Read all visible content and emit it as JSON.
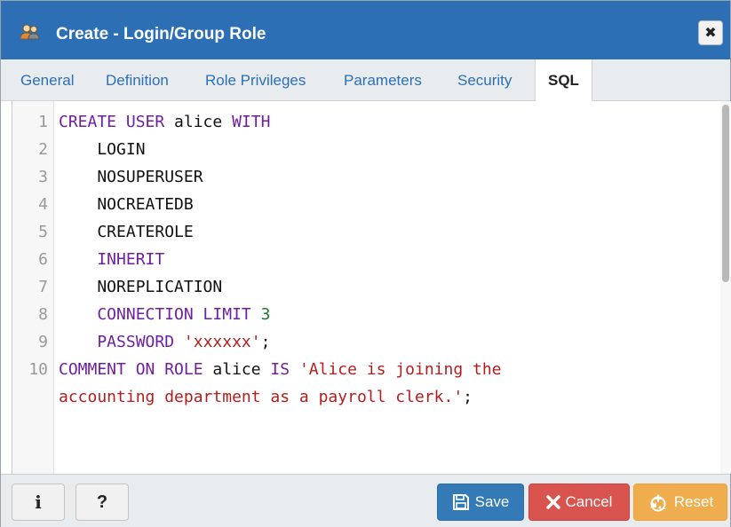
{
  "dialog": {
    "title": "Create - Login/Group Role",
    "close_glyph": "✖"
  },
  "tabs": [
    {
      "label": "General",
      "active": false
    },
    {
      "label": "Definition",
      "active": false
    },
    {
      "label": "Role Privileges",
      "active": false
    },
    {
      "label": "Parameters",
      "active": false
    },
    {
      "label": "Security",
      "active": false
    },
    {
      "label": "SQL",
      "active": true
    }
  ],
  "editor": {
    "lines": [
      {
        "number": "1",
        "tokens": [
          {
            "text": "CREATE USER ",
            "type": "kw"
          },
          {
            "text": "alice ",
            "type": "plain"
          },
          {
            "text": "WITH",
            "type": "kw"
          }
        ]
      },
      {
        "number": "2",
        "tokens": [
          {
            "text": "    LOGIN",
            "type": "plain"
          }
        ]
      },
      {
        "number": "3",
        "tokens": [
          {
            "text": "    NOSUPERUSER",
            "type": "plain"
          }
        ]
      },
      {
        "number": "4",
        "tokens": [
          {
            "text": "    NOCREATEDB",
            "type": "plain"
          }
        ]
      },
      {
        "number": "5",
        "tokens": [
          {
            "text": "    CREATEROLE",
            "type": "plain"
          }
        ]
      },
      {
        "number": "6",
        "tokens": [
          {
            "text": "    INHERIT",
            "type": "kw"
          }
        ]
      },
      {
        "number": "7",
        "tokens": [
          {
            "text": "    NOREPLICATION",
            "type": "plain"
          }
        ]
      },
      {
        "number": "8",
        "tokens": [
          {
            "text": "    CONNECTION LIMIT ",
            "type": "kw"
          },
          {
            "text": "3",
            "type": "num"
          }
        ]
      },
      {
        "number": "9",
        "tokens": [
          {
            "text": "    PASSWORD ",
            "type": "kw"
          },
          {
            "text": "'xxxxxx'",
            "type": "str"
          },
          {
            "text": ";",
            "type": "plain"
          }
        ]
      },
      {
        "number": "10",
        "tokens": [
          {
            "text": "COMMENT ON ROLE ",
            "type": "kw"
          },
          {
            "text": "alice ",
            "type": "plain"
          },
          {
            "text": "IS ",
            "type": "kw"
          },
          {
            "text": "'Alice is joining the",
            "type": "str"
          }
        ]
      },
      {
        "number": "",
        "tokens": [
          {
            "text": "accounting department as a payroll clerk.'",
            "type": "str"
          },
          {
            "text": ";",
            "type": "plain"
          }
        ]
      }
    ]
  },
  "footer": {
    "info_label": "i",
    "help_label": "?",
    "save_label": "Save",
    "cancel_label": "Cancel",
    "reset_label": "Reset"
  },
  "colors": {
    "titlebar": "#2c6fb5",
    "keyword": "#6f1f9f",
    "string": "#b31d1d",
    "number": "#1d7a2e",
    "save": "#337ab7",
    "cancel": "#d9534f",
    "reset": "#f0ad4e"
  },
  "icons": {
    "title": "user-group-icon",
    "save": "floppy-disk-icon",
    "cancel": "x-icon",
    "reset": "recycle-icon"
  }
}
